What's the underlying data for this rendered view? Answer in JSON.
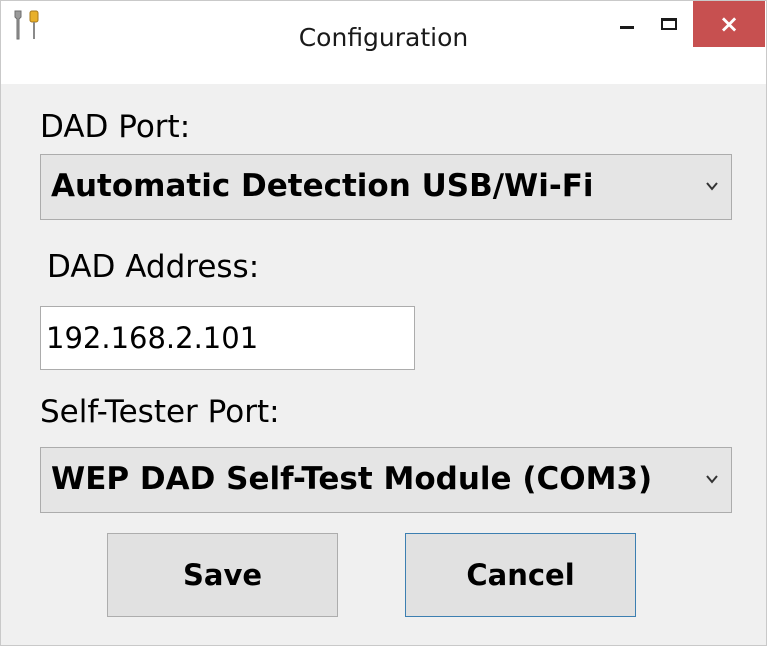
{
  "window": {
    "title": "Configuration",
    "icon": "tools-icon",
    "controls": {
      "minimize": "minimize-icon",
      "maximize": "maximize-icon",
      "close": "×"
    },
    "close_color": "#c75050"
  },
  "dad_port": {
    "label": "DAD Port:",
    "selected": "Automatic Detection USB/Wi-Fi"
  },
  "dad_address": {
    "label": "DAD Address:",
    "value": "192.168.2.101"
  },
  "self_tester_port": {
    "label": "Self-Tester Port:",
    "selected": "WEP DAD Self-Test Module (COM3)"
  },
  "buttons": {
    "save": "Save",
    "cancel": "Cancel"
  },
  "colors": {
    "focus_border": "#3c7fb1",
    "background": "#f0f0f0"
  }
}
